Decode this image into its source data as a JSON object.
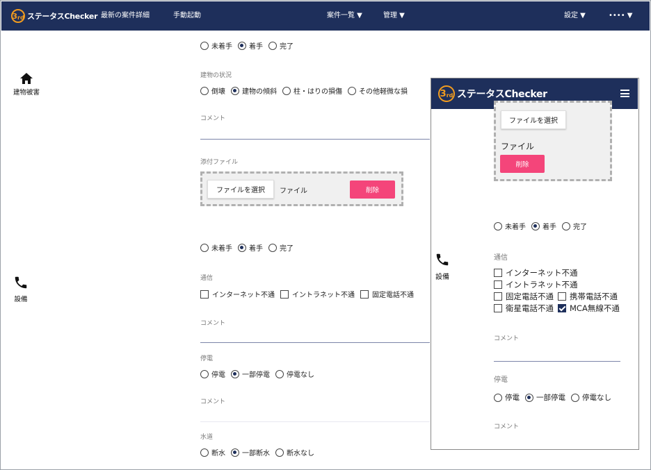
{
  "nav": {
    "logo_mark": "3",
    "logo_sub": "rd",
    "brand": "ステータスChecker",
    "latest": "最新の案件詳細",
    "manual": "手動起動",
    "cases": "案件一覧 ▼",
    "admin": "管理 ▼",
    "settings": "設定 ▼",
    "user": "•••• ▼"
  },
  "status_options": [
    "未着手",
    "着手",
    "完了"
  ],
  "building": {
    "section": "建物被害",
    "status_selected": "着手",
    "condition_label": "建物の状況",
    "condition_options": [
      "倒壊",
      "建物の傾斜",
      "柱・はりの損傷",
      "その他軽微な損"
    ],
    "condition_selected": "建物の傾斜",
    "comment_label": "コメント",
    "attach_label": "添付ファイル",
    "choose_file": "ファイルを選択",
    "file_text": "ファイル",
    "delete": "削除"
  },
  "equipment": {
    "section": "設備",
    "status_selected": "着手",
    "comm_label": "通信",
    "comm_options": [
      "インターネット不通",
      "イントラネット不通",
      "固定電話不通"
    ],
    "comment_label": "コメント",
    "power_label": "停電",
    "power_options": [
      "停電",
      "一部停電",
      "停電なし"
    ],
    "power_selected": "一部停電",
    "comment2_label": "コメント",
    "water_label": "水道",
    "water_options": [
      "断水",
      "一部断水",
      "断水なし"
    ],
    "water_selected": "一部断水"
  },
  "mobile": {
    "brand": "ステータスChecker",
    "choose_file": "ファイルを選択",
    "file_text": "ファイル",
    "delete": "削除",
    "status_selected": "着手",
    "section": "設備",
    "comm_label": "通信",
    "comm_options": [
      {
        "label": "インターネット不通",
        "checked": false
      },
      {
        "label": "イントラネット不通",
        "checked": false
      },
      {
        "label": "固定電話不通",
        "checked": false
      },
      {
        "label": "携帯電話不通",
        "checked": false
      },
      {
        "label": "衛星電話不通",
        "checked": false
      },
      {
        "label": "MCA無線不通",
        "checked": true
      }
    ],
    "comment_label": "コメント",
    "power_label": "停電",
    "power_options": [
      "停電",
      "一部停電",
      "停電なし"
    ],
    "power_selected": "一部停電",
    "comment2_label": "コメント"
  },
  "colors": {
    "nav": "#1e2f5b",
    "accent": "#f4457a",
    "logo": "#f29c1f"
  }
}
